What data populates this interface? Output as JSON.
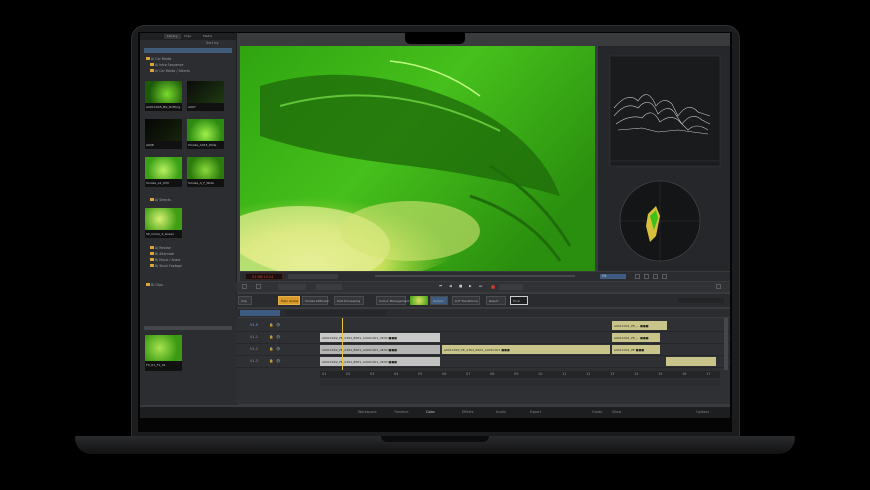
{
  "browser": {
    "tabs": [
      "Library",
      "Clips",
      "Media"
    ],
    "header_right": "Sort by",
    "tree": [
      "A/ Car Media",
      "A/ Intro Sequence",
      "A/ Car Media / Selects",
      "A/ Selects",
      "A/ Review",
      "B/ Alternate",
      "B/ Music / Score",
      "B/ Stock Footage",
      "B/ Clips"
    ],
    "thumbs": [
      {
        "caption": "A001C005_BG_Drifting",
        "badge": "4K"
      },
      {
        "caption": "A007",
        "badge": "4K"
      },
      {
        "caption": "A008",
        "badge": "4K"
      },
      {
        "caption": "Smoke_A013_Wide",
        "badge": "4K"
      },
      {
        "caption": "Smoke_A1_033",
        "badge": "4K"
      },
      {
        "caption": "Smoke_A_F_Wide",
        "badge": "4K"
      },
      {
        "caption": "SP_Comp_2_Green",
        "badge": "4K"
      },
      {
        "caption": "FX_01_F1_01",
        "badge": "4K"
      }
    ]
  },
  "viewer_controls": {
    "timecode": "01:08:13:14",
    "zoom": "Fit"
  },
  "nodes": [
    {
      "label": "Clip"
    },
    {
      "label": "Main Grade"
    },
    {
      "label": "Smoke Diffusion"
    },
    {
      "label": "Post Processing"
    },
    {
      "label": "Colour Management"
    },
    {
      "label": "Output"
    },
    {
      "label": "LUT Transforms"
    },
    {
      "label": "Result"
    },
    {
      "label": "Final"
    }
  ],
  "timeline": {
    "tracks": [
      {
        "name": "V1.0"
      },
      {
        "name": "V1.1"
      },
      {
        "name": "V1.2"
      },
      {
        "name": "V1.3"
      }
    ],
    "clips": [
      {
        "label": "A001C002_PE_2364_BXP1_A002C001_4K30 ■■■"
      },
      {
        "label": "A001C002_PE_2364_BXP1_A002C001_4K30 ■■■"
      },
      {
        "label": "A001C002_PE_2364_BXP1_A002C001_4K30 ■■■"
      },
      {
        "label": "A001C002_PE_2364_BXP1_A002C001 ■■■"
      },
      {
        "label": "A001C001_PE_... ■■■"
      },
      {
        "label": "A001C001_PE_... ■■■"
      },
      {
        "label": "A001C001_PE ■■■"
      }
    ],
    "ruler": [
      "01",
      "02",
      "03",
      "04",
      "05",
      "06",
      "07",
      "08",
      "09",
      "10",
      "11",
      "12",
      "13",
      "14",
      "15",
      "16",
      "17"
    ]
  },
  "bottom_tabs": [
    "Workspace",
    "Timeline",
    "Color",
    "Effects",
    "Audio",
    "Export"
  ],
  "bottom_right": [
    "Grade",
    "Show",
    "Options"
  ],
  "colors": {
    "accent": "#e3c545",
    "record": "#c23a2e",
    "green_screen": "#48c020",
    "clip": "#c9c58a"
  }
}
